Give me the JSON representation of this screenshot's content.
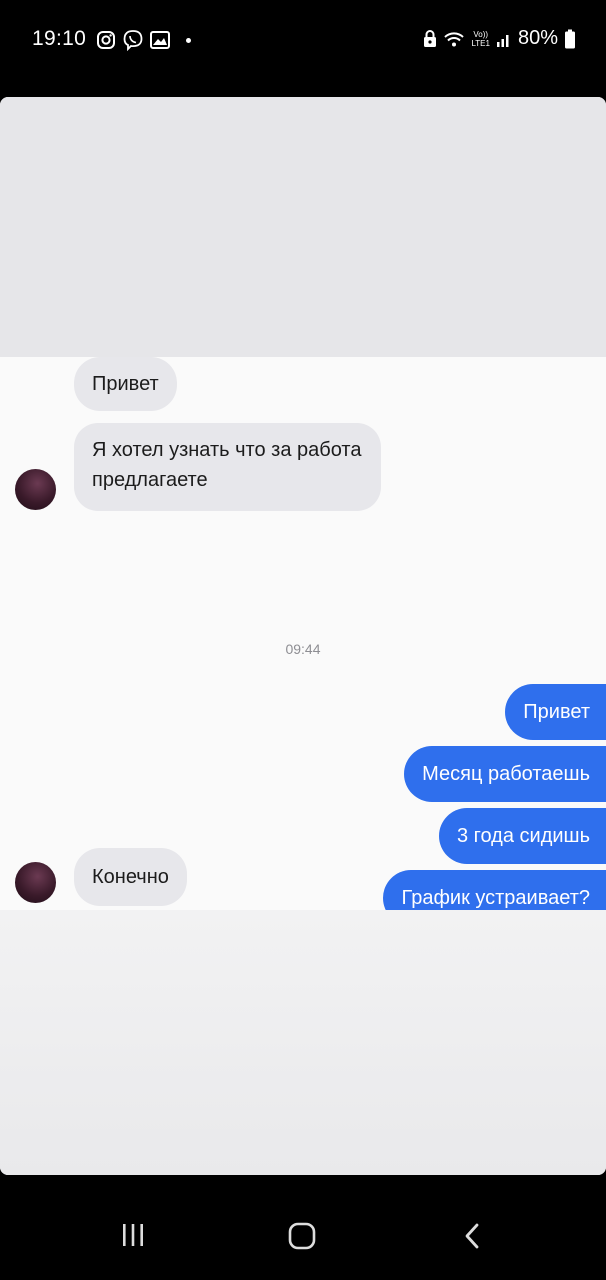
{
  "status_bar": {
    "time": "19:10",
    "left_icons": [
      "instagram-icon",
      "viber-icon",
      "gallery-icon"
    ],
    "right_icons": [
      "lock-icon",
      "wifi-icon",
      "volte-icon",
      "signal-icon"
    ],
    "volte_top": "Vo))",
    "volte_bottom": "LTE1",
    "battery": "80%"
  },
  "chat": {
    "incoming_group_1": [
      "Привет",
      "Я хотел узнать что за работа",
      "предлагаете"
    ],
    "timestamp": "09:44",
    "outgoing": [
      "Привет",
      "Месяц работаешь",
      "3 года сидишь",
      "График устраивает?"
    ],
    "incoming_group_2": [
      "Конечно"
    ]
  },
  "nav_bar": {
    "buttons": [
      "recent-apps-button",
      "home-button",
      "back-button"
    ]
  },
  "colors": {
    "outgoing_bubble": "#2f6fed",
    "incoming_bubble": "#e7e7eb"
  }
}
